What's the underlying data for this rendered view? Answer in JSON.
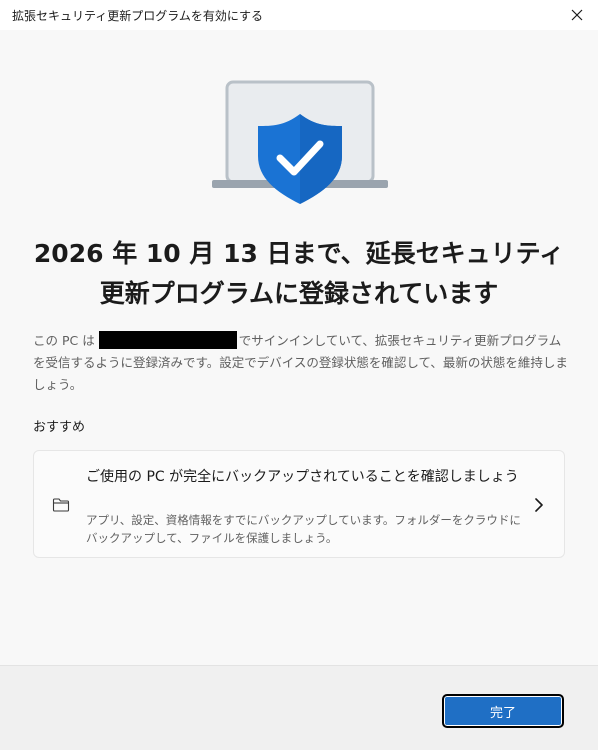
{
  "window": {
    "title": "拡張セキュリティ更新プログラムを有効にする",
    "close_icon": "close-icon"
  },
  "hero": {
    "icon": "laptop-shield-check-icon",
    "shield_color": "#1a73d4"
  },
  "heading": "2026 年 10 月 13 日まで、延長セキュリティ更新プログラムに登録されています",
  "description": {
    "before": "この PC は",
    "after": "でサインインしていて、拡張セキュリティ更新プログラムを受信するように登録済みです。設定でデバイスの登録状態を確認して、最新の状態を維持しましょう。"
  },
  "recommendation": {
    "label": "おすすめ",
    "card": {
      "icon": "folder-icon",
      "title": "ご使用の PC が完全にバックアップされていることを確認しましょう",
      "description": "アプリ、設定、資格情報をすでにバックアップしています。フォルダーをクラウドにバックアップして、ファイルを保護しましょう。",
      "chevron": "chevron-right-icon"
    }
  },
  "footer": {
    "done_label": "完了",
    "accent": "#1f6fc5"
  }
}
